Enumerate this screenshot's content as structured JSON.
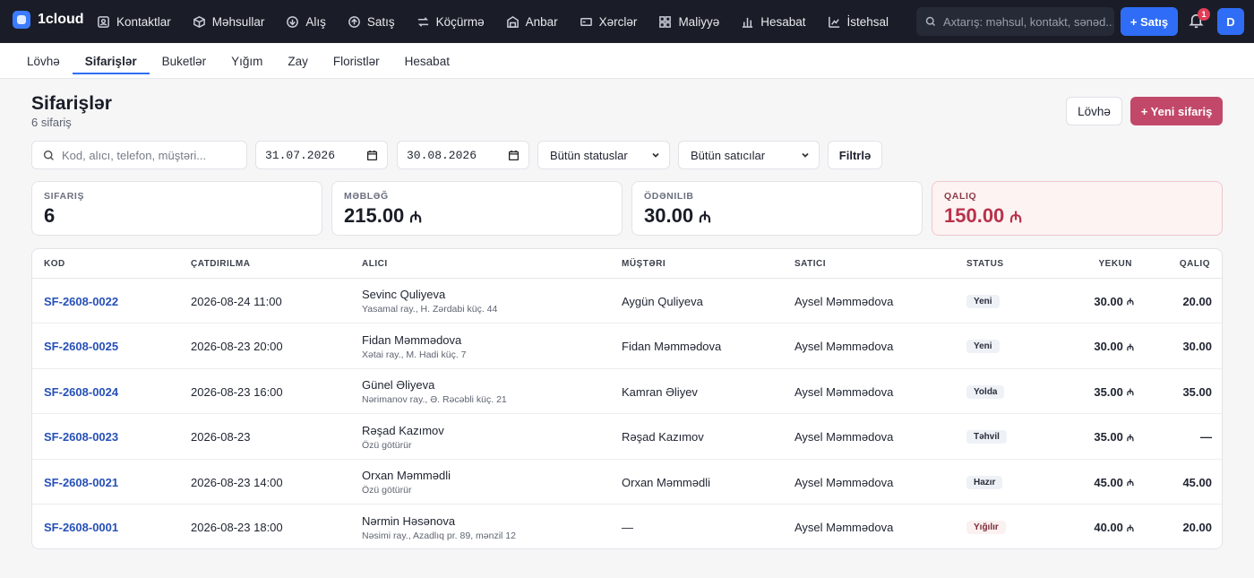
{
  "topbar": {
    "brand": "1cloud",
    "nav": [
      {
        "label": "Kontaktlar",
        "icon": "contacts-icon"
      },
      {
        "label": "Məhsullar",
        "icon": "box-icon"
      },
      {
        "label": "Alış",
        "icon": "purchase-icon"
      },
      {
        "label": "Satış",
        "icon": "sale-icon"
      },
      {
        "label": "Köçürmə",
        "icon": "transfer-icon"
      },
      {
        "label": "Anbar",
        "icon": "warehouse-icon"
      },
      {
        "label": "Xərclər",
        "icon": "expenses-icon"
      },
      {
        "label": "Maliyyə",
        "icon": "finance-icon"
      },
      {
        "label": "Hesabat",
        "icon": "report-icon"
      },
      {
        "label": "İstehsal",
        "icon": "production-icon"
      }
    ],
    "search_placeholder": "Axtarış: məhsul, kontakt, sənəd...",
    "sale_button": "+ Satış",
    "notifications_count": "1",
    "avatar_initial": "D"
  },
  "subnav": {
    "tabs": [
      "Lövhə",
      "Sifarişlər",
      "Buketlər",
      "Yığım",
      "Zay",
      "Floristlər",
      "Hesabat"
    ],
    "active_tab": "Sifarişlər"
  },
  "page": {
    "title": "Sifarişlər",
    "subtitle": "6 sifariş",
    "board_button": "Lövhə",
    "new_order_button": "+ Yeni sifariş"
  },
  "filters": {
    "search_placeholder": "Kod, alıcı, telefon, müştəri...",
    "date_from": "31.07.2026",
    "date_to": "30.08.2026",
    "status_select": "Bütün statuslar",
    "seller_select": "Bütün satıcılar",
    "filter_button": "Filtrlə"
  },
  "summary": {
    "orders": {
      "label": "Sifariş",
      "value": "6"
    },
    "amount": {
      "label": "Məbləğ",
      "value": "215.00"
    },
    "paid": {
      "label": "Ödənilib",
      "value": "30.00"
    },
    "remaining": {
      "label": "Qalıq",
      "value": "150.00"
    },
    "currency_symbol": "₼"
  },
  "table": {
    "headers": [
      "Kod",
      "Çatdırılma",
      "Alıcı",
      "Müştəri",
      "Satıcı",
      "Status",
      "Yekun",
      "Qalıq"
    ],
    "rows": [
      {
        "code": "SF-2608-0022",
        "delivery": "2026-08-24 11:00",
        "recipient": "Sevinc Quliyeva",
        "address": "Yasamal ray., H. Zərdabi küç. 44",
        "customer": "Aygün Quliyeva",
        "seller": "Aysel Məmmədova",
        "status": "Yeni",
        "total": "30.00",
        "remaining": "20.00"
      },
      {
        "code": "SF-2608-0025",
        "delivery": "2026-08-23 20:00",
        "recipient": "Fidan Məmmədova",
        "address": "Xətai ray., M. Hadi küç. 7",
        "customer": "Fidan Məmmədova",
        "seller": "Aysel Məmmədova",
        "status": "Yeni",
        "total": "30.00",
        "remaining": "30.00"
      },
      {
        "code": "SF-2608-0024",
        "delivery": "2026-08-23 16:00",
        "recipient": "Günel Əliyeva",
        "address": "Nərimanov ray., Ə. Rəcəbli küç. 21",
        "customer": "Kamran Əliyev",
        "seller": "Aysel Məmmədova",
        "status": "Yolda",
        "total": "35.00",
        "remaining": "35.00"
      },
      {
        "code": "SF-2608-0023",
        "delivery": "2026-08-23",
        "recipient": "Rəşad Kazımov",
        "address": "Özü götürür",
        "customer": "Rəşad Kazımov",
        "seller": "Aysel Məmmədova",
        "status": "Təhvil",
        "total": "35.00",
        "remaining": "—"
      },
      {
        "code": "SF-2608-0021",
        "delivery": "2026-08-23 14:00",
        "recipient": "Orxan Məmmədli",
        "address": "Özü götürür",
        "customer": "Orxan Məmmədli",
        "seller": "Aysel Məmmədova",
        "status": "Hazır",
        "total": "45.00",
        "remaining": "45.00"
      },
      {
        "code": "SF-2608-0001",
        "delivery": "2026-08-23 18:00",
        "recipient": "Nərmin Həsənova",
        "address": "Nəsimi ray., Azadlıq pr. 89, mənzil 12",
        "customer": "—",
        "seller": "Aysel Məmmədova",
        "status": "Yığılır",
        "total": "40.00",
        "remaining": "20.00"
      }
    ]
  },
  "colors": {
    "topbar": "#1a1d27",
    "accent_blue": "#2f6df6",
    "new_order_button": "#c2486a",
    "code_link": "#2650b8",
    "remaining_card_bg": "#fdf3f3",
    "remaining_value": "#b8324a"
  }
}
